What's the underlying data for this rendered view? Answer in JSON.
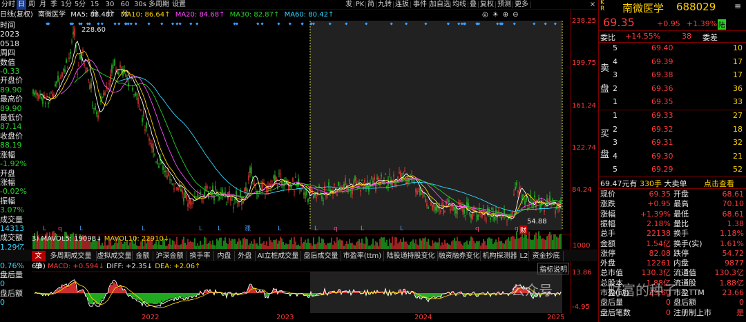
{
  "toolbar": {
    "left_tabs": [
      "分时",
      "日",
      "周",
      "月",
      "季",
      "1分",
      "5分",
      "15分",
      "30分",
      "60分",
      "30s",
      "多周期",
      "设置"
    ],
    "active_index": 1,
    "right_tabs": [
      "发",
      "PK",
      "简",
      "九转",
      "连扳",
      "事件",
      "加自选",
      "均线",
      "叠",
      "复权",
      "预测",
      "更多"
    ],
    "close_label": "×"
  },
  "ma_line": {
    "prefix": "日线(复权)",
    "name": "南微医学",
    "ma5": "MA5: 88.48↑",
    "ma10": "MA10: 86.64↑",
    "ma20": "MA20: 84.68↑",
    "ma30": "MA30: 82.87↑",
    "ma60": "MA60: 80.42↑"
  },
  "left_info": {
    "time_label": "时间",
    "year": "2023",
    "date": "0518",
    "weekday": "周四",
    "value_label": "数值",
    "value": "-0.33",
    "open_label": "开盘价",
    "open": "89.90",
    "high_label": "最高价",
    "high": "89.90",
    "low_label": "最低价",
    "low": "87.14",
    "close_label": "收盘价",
    "close": "88.19",
    "change_label": "涨幅",
    "change": "-1.92%",
    "open_change_label": "开盘",
    "open_change_label2": "涨幅",
    "open_change": "-0.02%",
    "amplitude_label": "振幅",
    "amplitude": "3.07%",
    "volume_label": "成交量",
    "volume": "14313",
    "amount_label": "成交额",
    "amount": "1.29亿",
    "turnover_label": "换手",
    "turnover": "0.76%",
    "after_volume_label": "盘后量",
    "after_volume": "0",
    "after_amount_label": "盘后额",
    "after_amount": "0"
  },
  "y_axis": [
    "238.25",
    "199.75",
    "161.24",
    "122.74",
    "84.24"
  ],
  "annotations": {
    "high_marker": "228.60",
    "low_marker": "54.88",
    "finance_tag": "财"
  },
  "volume_header": {
    "prefix": "3)",
    "mavol5": "MAVOL5: 19098↓",
    "mavol10": "MAVOL10: 22910↓",
    "vol_axis": "1000"
  },
  "tabs": [
    "文单",
    "多周期成交量",
    "虚拟成交量",
    "金额",
    "沪深金额",
    "换手率",
    "内盘",
    "外盘",
    "AI立桩成交量",
    "盘后成交量",
    "市盈率(ttm)",
    "陆股通持股变化",
    "融资融券变化",
    "机构探测器",
    "L2",
    "资金抄底"
  ],
  "active_tab": 0,
  "indicator_btn": "指标说明",
  "macd_line": {
    "prefix": "6,9)",
    "macd": "MACD: +0.594↓",
    "diff": "DIFF: +2.35↓",
    "dea": "DEA: +2.06↑"
  },
  "macd_axis": [
    "13.86",
    "-4.95"
  ],
  "x_axis": [
    "2022",
    "2023",
    "2024",
    "2025"
  ],
  "quote": {
    "name": "南微医学",
    "code": "688029",
    "tag_kr": "K\nR",
    "price": "69.35",
    "change": "+0.95",
    "pct": "+1.39%",
    "badge": "陆",
    "badge2": "≡",
    "weibi_label": "委比",
    "weibi": "+14.55%",
    "weibi_num": "38",
    "weicha_label": "委差",
    "sell_label": "卖盘",
    "buy_label": "买盘",
    "sells": [
      {
        "level": "5",
        "price": "69.40",
        "vol": "10"
      },
      {
        "level": "4",
        "price": "69.39",
        "vol": "17"
      },
      {
        "level": "3",
        "price": "69.38",
        "vol": "17"
      },
      {
        "level": "2",
        "price": "69.36",
        "vol": "36"
      },
      {
        "level": "1",
        "price": "69.35",
        "vol": "33"
      }
    ],
    "buys": [
      {
        "level": "1",
        "price": "69.33",
        "vol": "27"
      },
      {
        "level": "2",
        "price": "69.32",
        "vol": "18"
      },
      {
        "level": "3",
        "price": "69.31",
        "vol": "32"
      },
      {
        "level": "4",
        "price": "69.30",
        "vol": "21"
      },
      {
        "level": "5",
        "price": "69.29",
        "vol": "52"
      }
    ],
    "big_order_left": "69.47元有",
    "big_order_num": "330手",
    "big_order_type": "大卖单",
    "big_order_link": "点击查看",
    "stats": [
      [
        "现价",
        "69.35",
        "开盘",
        "68.61"
      ],
      [
        "涨跌",
        "+0.95",
        "最高",
        "70.10"
      ],
      [
        "涨幅",
        "+1.39%",
        "最低",
        "68.61"
      ],
      [
        "振幅",
        "2.18%",
        "量比",
        "1.38"
      ],
      [
        "总手",
        "22138",
        "换手",
        "1.18%"
      ],
      [
        "金额",
        "1.54亿",
        "换手(实)",
        "1.61%"
      ],
      [
        "涨停",
        "82.08",
        "跌停",
        "54.72"
      ],
      [
        "外盘",
        "12261",
        "内盘",
        "9877"
      ],
      [
        "总市值",
        "130.3亿",
        "流通值",
        "130.3亿"
      ],
      [
        "总股本",
        "1.88亿",
        "流通股",
        "1.88亿"
      ],
      [
        "市盈(动)",
        "23.60",
        "市盈TTM",
        "23.66"
      ],
      [
        "盘后量",
        "0",
        "盘后额",
        "0"
      ],
      [
        "盘后笔数",
        "0",
        "注册制上市",
        "是"
      ]
    ]
  },
  "watermark": "公众号",
  "watermark2": "财富的种子",
  "colors": {
    "up": "#ff3a3a",
    "down": "#28d228",
    "ma5": "#ffffff",
    "ma10": "#ffd200",
    "ma20": "#ff4cff",
    "ma30": "#28d228",
    "ma60": "#34d8ff"
  }
}
